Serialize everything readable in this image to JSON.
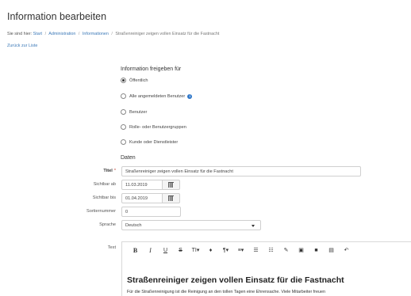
{
  "page": {
    "title": "Information bearbeiten"
  },
  "breadcrumb": {
    "prefix": "Sie sind hier:",
    "items": [
      "Start",
      "Administration",
      "Informationen"
    ],
    "current": "Straßenreiniger zeigen vollen Einsatz für die Fastnacht",
    "separator": "/"
  },
  "back_link": "Zurück zur Liste",
  "release": {
    "heading": "Information freigeben für",
    "options": [
      {
        "label": "Öffentlich",
        "selected": true
      },
      {
        "label": "Alle angemeldeten Benutzer",
        "selected": false,
        "info_icon": "info-circle-icon"
      },
      {
        "label": "Benutzer",
        "selected": false
      },
      {
        "label": "Rolle- oder Benutzergruppen",
        "selected": false
      },
      {
        "label": "Kunde oder Dienstleister",
        "selected": false
      }
    ]
  },
  "data_section": {
    "heading": "Daten"
  },
  "fields": {
    "title": {
      "label": "Titel",
      "required_mark": "*",
      "value": "Straßenreiniger zeigen vollen Einsatz für die Fastnacht"
    },
    "visible_from": {
      "label": "Sichtbar ab",
      "value": "11.03.2019",
      "icon": "calendar-icon"
    },
    "visible_to": {
      "label": "Sichtbar bis",
      "value": "01.04.2019",
      "icon": "calendar-icon"
    },
    "sort_number": {
      "label": "Sortiernummer",
      "value": "0"
    },
    "language": {
      "label": "Sprache",
      "value": "Deutsch",
      "icon": "caret-down-icon"
    },
    "text": {
      "label": "Text"
    }
  },
  "editor": {
    "toolbar": [
      {
        "name": "bold",
        "glyph": "B"
      },
      {
        "name": "italic",
        "glyph": "I"
      },
      {
        "name": "underline",
        "glyph": "U"
      },
      {
        "name": "strikethrough",
        "glyph": "S"
      },
      {
        "name": "font-size",
        "glyph": "TI▾"
      },
      {
        "name": "color",
        "glyph": "♦"
      },
      {
        "name": "paragraph",
        "glyph": "¶▾"
      },
      {
        "name": "align",
        "glyph": "≡▾"
      },
      {
        "name": "unordered-list",
        "glyph": "☰"
      },
      {
        "name": "ordered-list",
        "glyph": "☷"
      },
      {
        "name": "link",
        "glyph": "✎"
      },
      {
        "name": "image",
        "glyph": "▣"
      },
      {
        "name": "video",
        "glyph": "■"
      },
      {
        "name": "table",
        "glyph": "▤"
      },
      {
        "name": "undo",
        "glyph": "↶"
      }
    ],
    "heading": "Straßenreiniger zeigen vollen Einsatz für die Fastnacht",
    "paragraph": "Für die Straßenreinigung ist die Reinigung an den tollen Tagen eine Ehrensache. Viele Mitarbeiter freuen"
  },
  "colors": {
    "link": "#3d7ab8",
    "required": "#c0392b",
    "info": "#2f77c9"
  }
}
